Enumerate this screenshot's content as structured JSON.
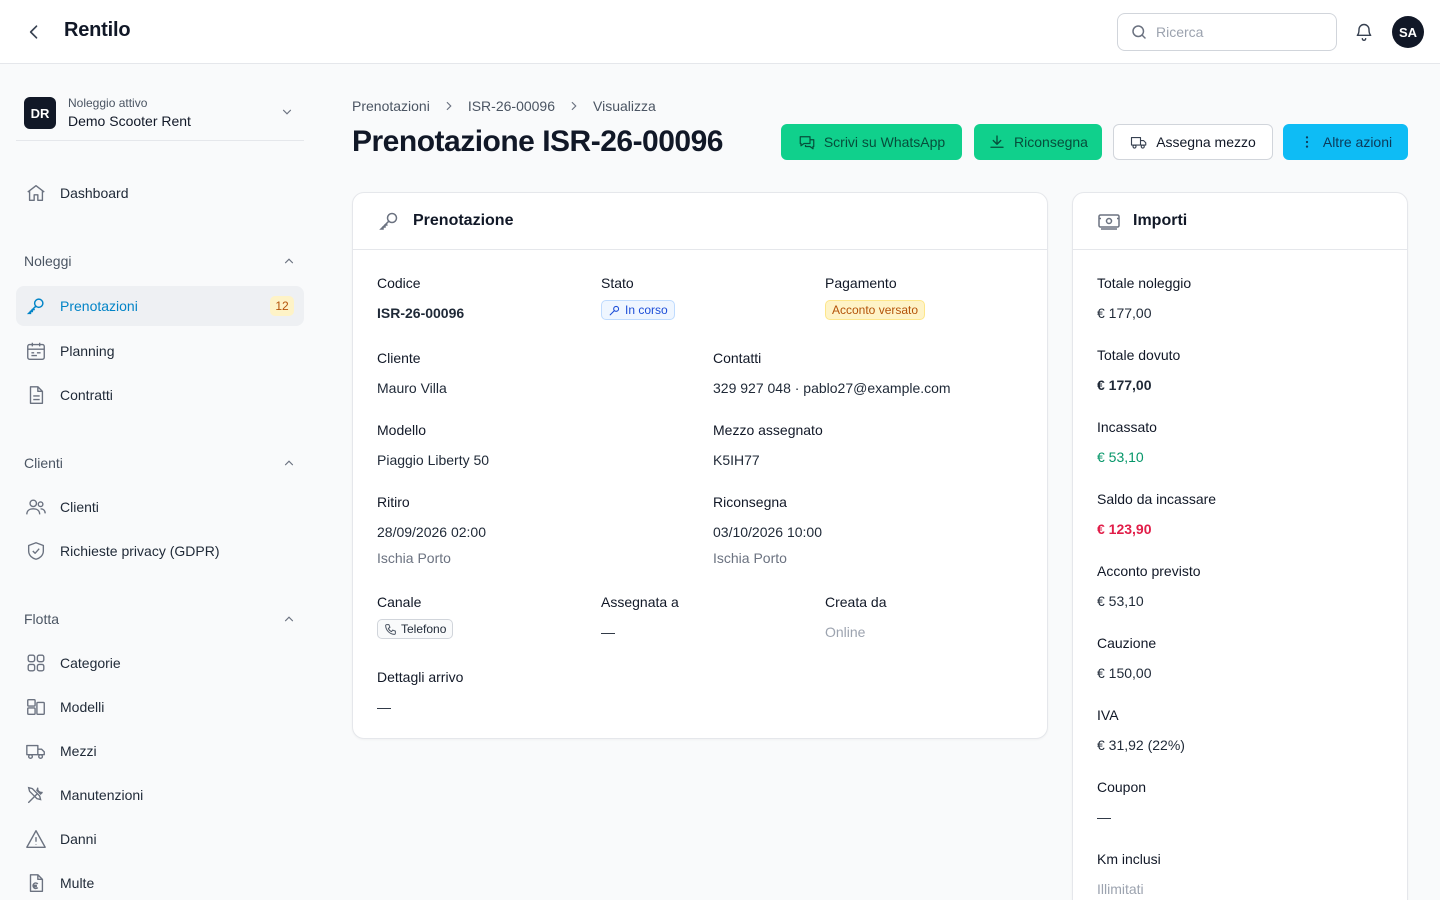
{
  "app": {
    "title": "Rentilo"
  },
  "search": {
    "placeholder": "Ricerca"
  },
  "user": {
    "initials": "SA"
  },
  "tenant": {
    "initials": "DR",
    "label": "Noleggio attivo",
    "name": "Demo Scooter Rent"
  },
  "sidebar": {
    "dashboard": "Dashboard",
    "sections": {
      "noleggi": "Noleggi",
      "clienti": "Clienti",
      "flotta": "Flotta"
    },
    "items": {
      "prenotazioni": {
        "label": "Prenotazioni",
        "badge": "12"
      },
      "planning": "Planning",
      "contratti": "Contratti",
      "clienti": "Clienti",
      "privacy": "Richieste privacy (GDPR)",
      "categorie": "Categorie",
      "modelli": "Modelli",
      "mezzi": "Mezzi",
      "manutenzioni": "Manutenzioni",
      "danni": "Danni",
      "multe": "Multe"
    }
  },
  "breadcrumb": [
    "Prenotazioni",
    "ISR-26-00096",
    "Visualizza"
  ],
  "page": {
    "title": "Prenotazione ISR-26-00096"
  },
  "actions": {
    "whatsapp": "Scrivi su WhatsApp",
    "ritorno": "Riconsegna",
    "assegna": "Assegna mezzo",
    "altre": "Altre azioni"
  },
  "booking": {
    "title": "Prenotazione",
    "codice": {
      "label": "Codice",
      "value": "ISR-26-00096"
    },
    "stato": {
      "label": "Stato",
      "value": "In corso"
    },
    "pagamento": {
      "label": "Pagamento",
      "value": "Acconto versato"
    },
    "cliente": {
      "label": "Cliente",
      "value": "Mauro Villa"
    },
    "contatti": {
      "label": "Contatti",
      "value": "329 927 048 · pablo27@example.com"
    },
    "modello": {
      "label": "Modello",
      "value": "Piaggio Liberty 50"
    },
    "mezzo": {
      "label": "Mezzo assegnato",
      "value": "K5IH77"
    },
    "ritiro": {
      "label": "Ritiro",
      "date": "28/09/2026 02:00",
      "place": "Ischia Porto"
    },
    "riconsegna": {
      "label": "Riconsegna",
      "date": "03/10/2026 10:00",
      "place": "Ischia Porto"
    },
    "canale": {
      "label": "Canale",
      "value": "Telefono"
    },
    "assegnata": {
      "label": "Assegnata a",
      "value": "—"
    },
    "creata": {
      "label": "Creata da",
      "value": "Online"
    },
    "arrivo": {
      "label": "Dettagli arrivo",
      "value": "—"
    }
  },
  "importi": {
    "title": "Importi",
    "rows": [
      {
        "label": "Totale noleggio",
        "value": "€ 177,00"
      },
      {
        "label": "Totale dovuto",
        "value": "€ 177,00"
      },
      {
        "label": "Incassato",
        "value": "€ 53,10"
      },
      {
        "label": "Saldo da incassare",
        "value": "€ 123,90"
      },
      {
        "label": "Acconto previsto",
        "value": "€ 53,10"
      },
      {
        "label": "Cauzione",
        "value": "€ 150,00"
      },
      {
        "label": "IVA",
        "value": "€ 31,92 (22%)"
      },
      {
        "label": "Coupon",
        "value": "—"
      },
      {
        "label": "Km inclusi",
        "value": "Illimitati"
      }
    ]
  },
  "colors": {
    "accent": "#0284c7",
    "whatsapp": "#10d08c",
    "primary": "#0ebcf5",
    "danger": "#e11d48",
    "success": "#059669"
  }
}
